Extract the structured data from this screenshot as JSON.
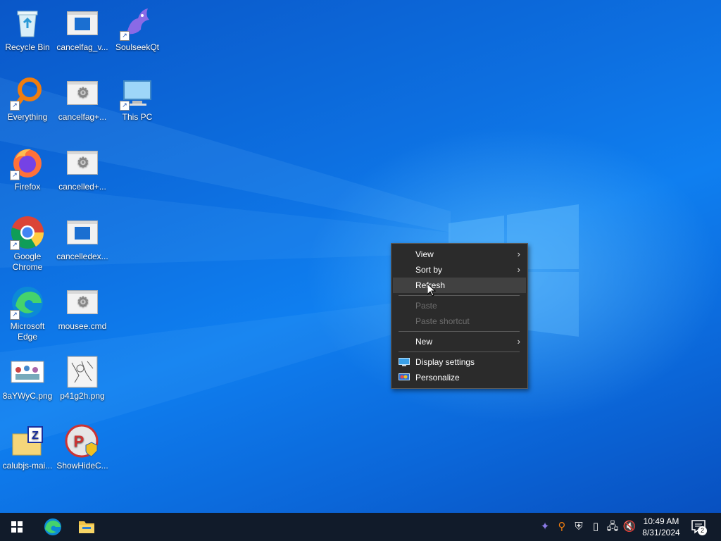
{
  "desktop": {
    "icons": [
      {
        "label": "Recycle Bin"
      },
      {
        "label": "cancelfag_v..."
      },
      {
        "label": "SoulseekQt"
      },
      {
        "label": "Everything"
      },
      {
        "label": "cancelfag+..."
      },
      {
        "label": "This PC"
      },
      {
        "label": "Firefox"
      },
      {
        "label": "cancelled+..."
      },
      {
        "label": "Google Chrome"
      },
      {
        "label": "cancelledex..."
      },
      {
        "label": "Microsoft Edge"
      },
      {
        "label": "mousee.cmd"
      },
      {
        "label": "8aYWyC.png"
      },
      {
        "label": "p41g2h.png"
      },
      {
        "label": "calubjs-mai..."
      },
      {
        "label": "ShowHideC..."
      }
    ]
  },
  "context_menu": {
    "items": {
      "view": "View",
      "sort_by": "Sort by",
      "refresh": "Refresh",
      "paste": "Paste",
      "paste_shortcut": "Paste shortcut",
      "new": "New",
      "display_settings": "Display settings",
      "personalize": "Personalize"
    },
    "submenu_arrow": "›"
  },
  "taskbar": {
    "time": "10:49 AM",
    "date": "8/31/2024",
    "notification_count": "2"
  },
  "colors": {
    "accent": "#0f7ff0",
    "menu_bg": "#2b2b2b",
    "taskbar_bg": "#111b2a"
  }
}
